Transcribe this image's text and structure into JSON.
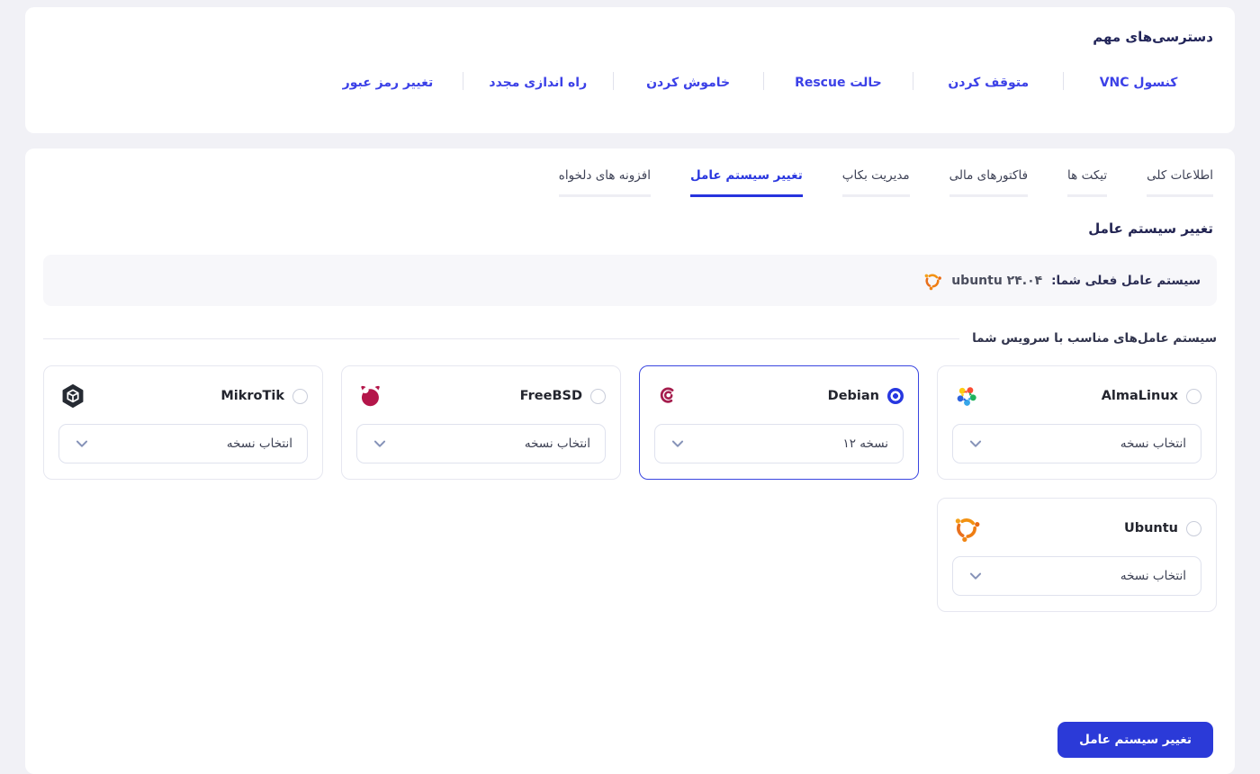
{
  "quick_access": {
    "title": "دسترسی‌های مهم",
    "links": [
      "کنسول VNC",
      "متوقف کردن",
      "حالت Rescue",
      "خاموش کردن",
      "راه اندازی مجدد",
      "تغییر رمز عبور"
    ]
  },
  "tabs": [
    {
      "label": "اطلاعات کلی",
      "active": false
    },
    {
      "label": "تیکت ها",
      "active": false
    },
    {
      "label": "فاکتورهای مالی",
      "active": false
    },
    {
      "label": "مدیریت بکاپ",
      "active": false
    },
    {
      "label": "تغییر سیستم عامل",
      "active": true
    },
    {
      "label": "افزونه های دلخواه",
      "active": false
    }
  ],
  "os_section": {
    "title": "تغییر سیستم عامل",
    "current_os_label": "سیستم عامل فعلی شما:",
    "current_os_value": "ubuntu ۲۴.۰۴",
    "current_os_icon": "ubuntu-logo-icon",
    "suitable_heading": "سیستم عامل‌های مناسب با سرویس شما",
    "cards": [
      {
        "name": "AlmaLinux",
        "icon": "almalinux-logo-icon",
        "selected": false,
        "dropdown_label": "انتخاب نسخه"
      },
      {
        "name": "Debian",
        "icon": "debian-logo-icon",
        "selected": true,
        "dropdown_label": "نسخه ۱۲"
      },
      {
        "name": "FreeBSD",
        "icon": "freebsd-logo-icon",
        "selected": false,
        "dropdown_label": "انتخاب نسخه"
      },
      {
        "name": "MikroTik",
        "icon": "mikrotik-logo-icon",
        "selected": false,
        "dropdown_label": "انتخاب نسخه"
      },
      {
        "name": "Ubuntu",
        "icon": "ubuntu-logo-icon",
        "selected": false,
        "dropdown_label": "انتخاب نسخه"
      }
    ],
    "submit_button": "تغییر سیستم عامل"
  },
  "icons": {
    "dropdown": "chevron-down-icon",
    "radio": "radio-button"
  },
  "colors": {
    "page_background": "#f1f1f6",
    "panel_background": "#ffffff",
    "link_blue": "#3c41e7",
    "active_tab_blue": "#2b38df",
    "button_blue": "#2b3ad8",
    "heading_navy": "#23265a",
    "selected_border": "#3a46e0",
    "current_os_bar": "#f7f7fa"
  }
}
